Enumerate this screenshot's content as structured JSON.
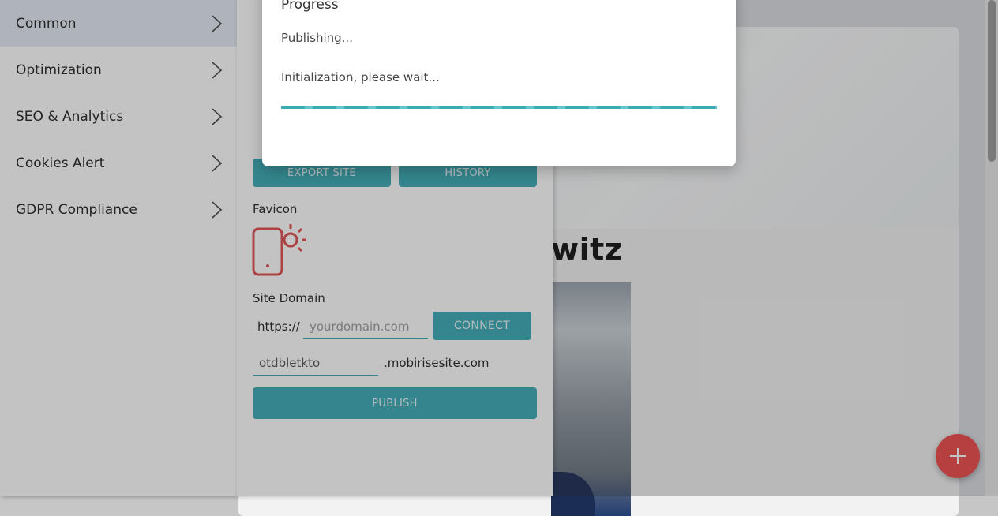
{
  "site": {
    "heading_fragment": "witz"
  },
  "sidebar": {
    "items": [
      {
        "label": "Common",
        "active": true
      },
      {
        "label": "Optimization"
      },
      {
        "label": "SEO & Analytics"
      },
      {
        "label": "Cookies Alert"
      },
      {
        "label": "GDPR Compliance"
      }
    ]
  },
  "panel": {
    "export_button": "EXPORT SITE",
    "history_button": "HISTORY",
    "favicon_label": "Favicon",
    "domain_label": "Site Domain",
    "protocol": "https://",
    "domain_placeholder": "yourdomain.com",
    "connect_button": "CONNECT",
    "subdomain_value": "otdbletkto",
    "subdomain_suffix": ".mobirisesite.com",
    "publish_button": "PUBLISH"
  },
  "modal": {
    "title": "Progress",
    "status": "Publishing...",
    "detail": "Initialization, please wait..."
  },
  "colors": {
    "accent": "#3aaab4",
    "favicon": "#e24b4b",
    "fab": "#ee4a4a"
  },
  "icons": {
    "chevron": "chevron-right-icon",
    "favicon": "phone-sun-icon",
    "fab": "plus-icon"
  }
}
